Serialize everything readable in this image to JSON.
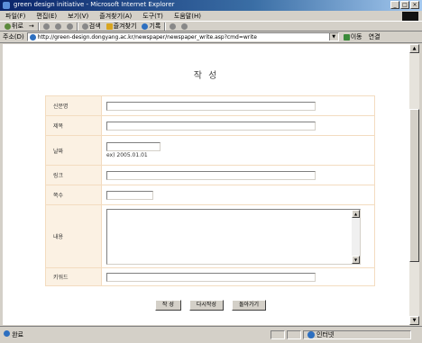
{
  "window": {
    "title": "green design initiative - Microsoft Internet Explorer",
    "buttons": [
      "_",
      "□",
      "×"
    ]
  },
  "menubar": {
    "items": [
      "파일(F)",
      "편집(E)",
      "보기(V)",
      "즐겨찾기(A)",
      "도구(T)",
      "도움말(H)"
    ]
  },
  "toolbar": {
    "back": "뒤로",
    "forward": "→",
    "stop": "중지",
    "refresh": "새로고침",
    "home": "홈",
    "search": "검색",
    "favorites": "즐겨찾기",
    "history": "기록",
    "mail": "메일",
    "print": "인쇄"
  },
  "addressbar": {
    "label": "주소(D)",
    "url": "http://green-design.dongyang.ac.kr/newspaper/newspaper_write.asp?cmd=write",
    "go": "이동",
    "links": "연결"
  },
  "page": {
    "title": "작 성",
    "fields": [
      {
        "label": "신문명",
        "value": ""
      },
      {
        "label": "제목",
        "value": ""
      },
      {
        "label": "날짜",
        "value": "",
        "hint": "ex) 2005.01.01"
      },
      {
        "label": "링크",
        "value": ""
      },
      {
        "label": "쪽수",
        "value": ""
      },
      {
        "label": "내용",
        "value": ""
      },
      {
        "label": "키워드",
        "value": ""
      }
    ],
    "buttons": {
      "write": "작 성",
      "rewrite": "다시작성",
      "back": "돌아가기"
    }
  },
  "statusbar": {
    "left": "완료",
    "zone": "인터넷"
  }
}
